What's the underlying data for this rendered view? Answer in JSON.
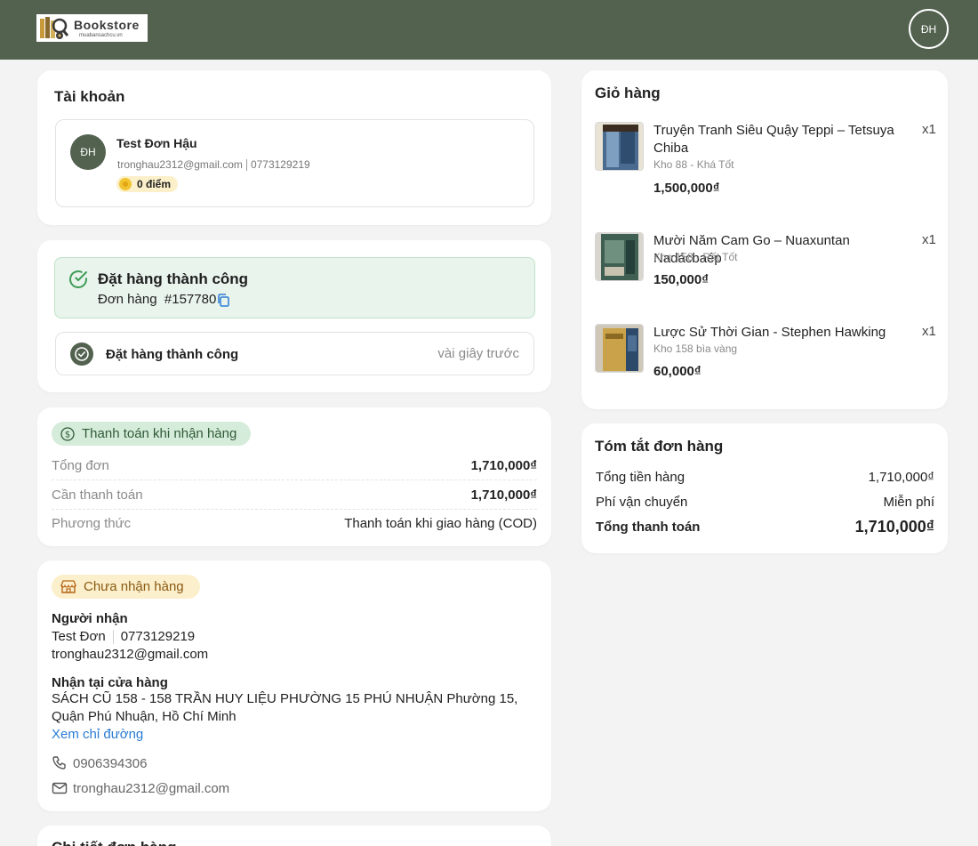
{
  "header": {
    "logo": {
      "title": "Bookstore",
      "subtitle": "muabansachcu.vn"
    },
    "avatar_initials": "ĐH",
    "colors": {
      "bar": "#52624f"
    }
  },
  "account": {
    "title": "Tài khoản",
    "avatar_initials": "ĐH",
    "name": "Test Đơn Hậu",
    "email": "tronghau2312@gmail.com",
    "phone": "0773129219",
    "points": "0 điểm"
  },
  "order": {
    "success_title": "Đặt hàng thành công",
    "order_label": "Đơn hàng",
    "order_number": "#157780",
    "status_label": "Đặt hàng thành công",
    "status_time": "vài giây trước"
  },
  "payment": {
    "badge": "Thanh toán khi nhận hàng",
    "rows": [
      {
        "label": "Tổng đơn",
        "value": "1,710,000₫"
      },
      {
        "label": "Cần thanh toán",
        "value": "1,710,000₫"
      },
      {
        "label": "Phương thức",
        "value": "Thanh toán khi giao hàng (COD)"
      }
    ]
  },
  "delivery": {
    "badge": "Chưa nhận hàng",
    "recipient_label": "Người nhận",
    "recipient_name": "Test Đơn",
    "recipient_phone": "0773129219",
    "recipient_email": "tronghau2312@gmail.com",
    "pickup_label": "Nhận tại cửa hàng",
    "store_address": "SÁCH CŨ 158 - 158 TRẦN HUY LIỆU PHƯỜNG 15 PHÚ NHUẬN Phường 15, Quận Phú Nhuận, Hồ Chí Minh",
    "directions_link": "Xem chỉ đường",
    "store_phone": "0906394306",
    "store_email": "tronghau2312@gmail.com"
  },
  "next_section_title": "Chi tiết đơn hàng",
  "cart": {
    "title": "Giỏ hàng",
    "items": [
      {
        "name": "Truyện Tranh Siêu Quậy Teppi – Tetsuya Chiba",
        "stock": "Kho 88 - Khá Tốt",
        "price": "1,500,000₫",
        "qty": "x1"
      },
      {
        "name": "Mười Năm Cam Go – Nuaxuntan Nadácbaép",
        "stock": "Kho 158 - Rất Tốt",
        "price": "150,000₫",
        "qty": "x1"
      },
      {
        "name": "Lược Sử Thời Gian - Stephen Hawking",
        "stock": "Kho 158 bìa vàng",
        "price": "60,000₫",
        "qty": "x1"
      }
    ]
  },
  "summary": {
    "title": "Tóm tắt đơn hàng",
    "subtotal_label": "Tổng tiền hàng",
    "subtotal": "1,710,000₫",
    "shipping_label": "Phí vận chuyển",
    "shipping": "Miễn phí",
    "total_label": "Tổng thanh toán",
    "total": "1,710,000₫"
  }
}
